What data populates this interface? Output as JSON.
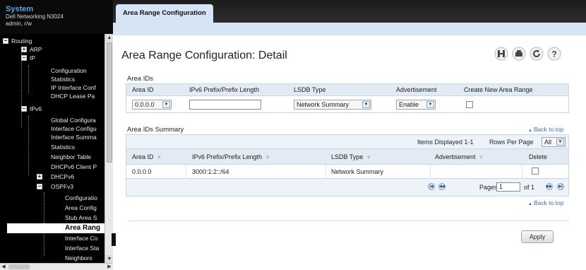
{
  "system": {
    "title": "System",
    "device": "Dell Networking N3024",
    "user": "admin, r/w"
  },
  "tree": {
    "items": [
      {
        "label": "Routing",
        "box": "−"
      },
      {
        "label": "ARP",
        "box": "+"
      },
      {
        "label": "IP",
        "box": "−"
      },
      {
        "label": "Configuration"
      },
      {
        "label": "Statistics"
      },
      {
        "label": "IP Interface Conf"
      },
      {
        "label": "DHCP Lease Pa"
      },
      {
        "label": "IPv6",
        "box": "−"
      },
      {
        "label": "Global Configura"
      },
      {
        "label": "Interface Configu"
      },
      {
        "label": "Interface Summa"
      },
      {
        "label": "Statistics"
      },
      {
        "label": "Neighbor Table"
      },
      {
        "label": "DHCPv6 Client P"
      },
      {
        "label": "DHCPv6",
        "box": "+"
      },
      {
        "label": "OSPFv3",
        "box": "−"
      },
      {
        "label": "Configuratio"
      },
      {
        "label": "Area Config"
      },
      {
        "label": "Stub Area S"
      },
      {
        "label": "Area Rang",
        "selected": true
      },
      {
        "label": "Interface Co"
      },
      {
        "label": "Interface Sta"
      },
      {
        "label": "Neighbors"
      }
    ]
  },
  "tab": {
    "label": "Area Range Configuration"
  },
  "page": {
    "title": "Area Range Configuration: Detail"
  },
  "icons": [
    "save-icon",
    "print-icon",
    "refresh-icon",
    "help-icon"
  ],
  "area_ids": {
    "label": "Area IDs",
    "headers": [
      "Area ID",
      "IPv6 Prefix/Prefix Length",
      "LSDB Type",
      "Advertisement",
      "Create New Area Range"
    ],
    "area_id": "0.0.0.0",
    "prefix_value": "",
    "lsdb_type": "Network Summary",
    "advertisement": "Enable"
  },
  "summary": {
    "label": "Area IDs Summary",
    "back_to_top": "Back to top",
    "items_displayed": "Items Displayed 1-1",
    "rows_per_page_label": "Rows Per Page",
    "rows_per_page_value": "All",
    "headers": [
      "Area ID",
      "IPv6 Prefix/Prefix Length",
      "LSDB Type",
      "Advertisement",
      "Delete"
    ],
    "rows": [
      {
        "area_id": "0.0.0.0",
        "prefix": "3000:1:2::/64",
        "lsdb": "Network Summary",
        "advertisement": ""
      }
    ],
    "pages_label": "Pages",
    "page_value": "1",
    "of_label": "of 1"
  },
  "back_to_top_2": "Back to top",
  "apply_label": "Apply",
  "colors": {
    "accent": "#3a6ea8",
    "header_bg": "#e2eaf4",
    "tab_bg": "#d6e4f5",
    "sidebar_bg": "#000000"
  }
}
